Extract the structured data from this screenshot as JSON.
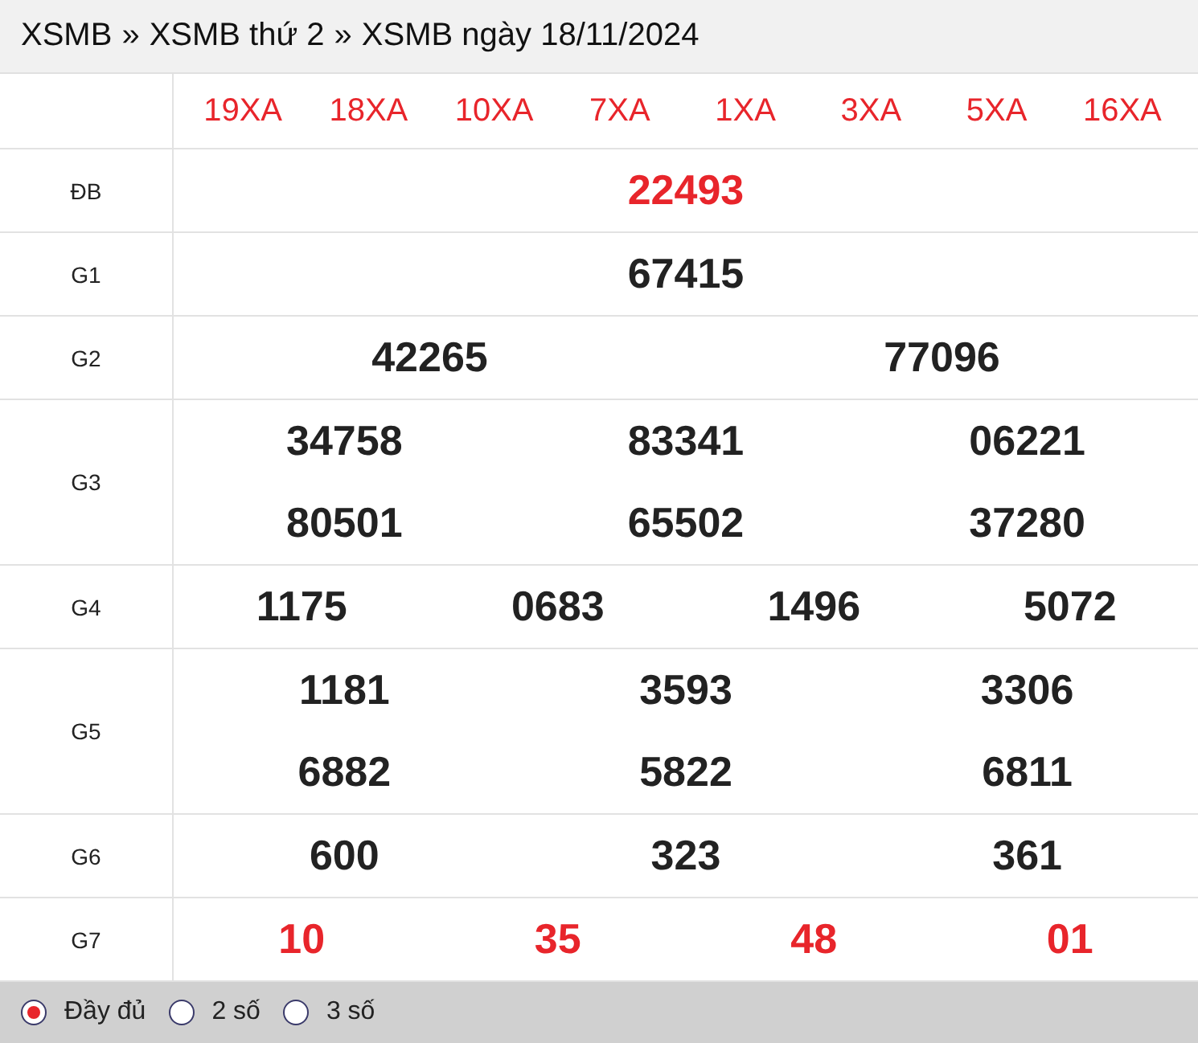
{
  "breadcrumb": [
    "XSMB",
    "XSMB thứ 2",
    "XSMB ngày 18/11/2024"
  ],
  "breadcrumb_separator": "»",
  "codes": [
    "19XA",
    "18XA",
    "10XA",
    "7XA",
    "1XA",
    "3XA",
    "5XA",
    "16XA"
  ],
  "prizes": [
    {
      "label": "ĐB",
      "highlight": true,
      "numbers": [
        "22493"
      ]
    },
    {
      "label": "G1",
      "highlight": false,
      "numbers": [
        "67415"
      ]
    },
    {
      "label": "G2",
      "highlight": false,
      "numbers": [
        "42265",
        "77096"
      ]
    },
    {
      "label": "G3",
      "highlight": false,
      "numbers": [
        "34758",
        "83341",
        "06221",
        "80501",
        "65502",
        "37280"
      ]
    },
    {
      "label": "G4",
      "highlight": false,
      "numbers": [
        "1175",
        "0683",
        "1496",
        "5072"
      ]
    },
    {
      "label": "G5",
      "highlight": false,
      "numbers": [
        "1181",
        "3593",
        "3306",
        "6882",
        "5822",
        "6811"
      ]
    },
    {
      "label": "G6",
      "highlight": false,
      "numbers": [
        "600",
        "323",
        "361"
      ]
    },
    {
      "label": "G7",
      "highlight": true,
      "numbers": [
        "10",
        "35",
        "48",
        "01"
      ]
    }
  ],
  "display_options": [
    {
      "label": "Đầy đủ",
      "selected": true
    },
    {
      "label": "2 số",
      "selected": false
    },
    {
      "label": "3 số",
      "selected": false
    }
  ]
}
